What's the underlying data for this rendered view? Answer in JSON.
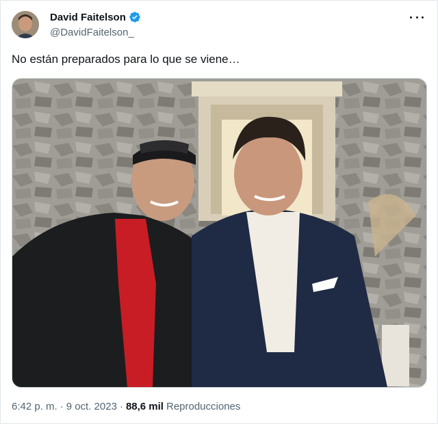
{
  "author": {
    "name": "David Faitelson",
    "handle": "@DavidFaitelson_",
    "verified": true
  },
  "tweet": {
    "text": "No están preparados para lo que se viene…"
  },
  "meta": {
    "time": "6:42 p. m.",
    "separator": "·",
    "date": "9 oct. 2023",
    "views_count": "88,6 mil",
    "views_label": "Reproducciones"
  },
  "icons": {
    "verified": "verified-badge-icon",
    "more": "more-options-icon"
  },
  "colors": {
    "accent": "#1d9bf0",
    "text": "#0f1419",
    "muted": "#536471"
  }
}
